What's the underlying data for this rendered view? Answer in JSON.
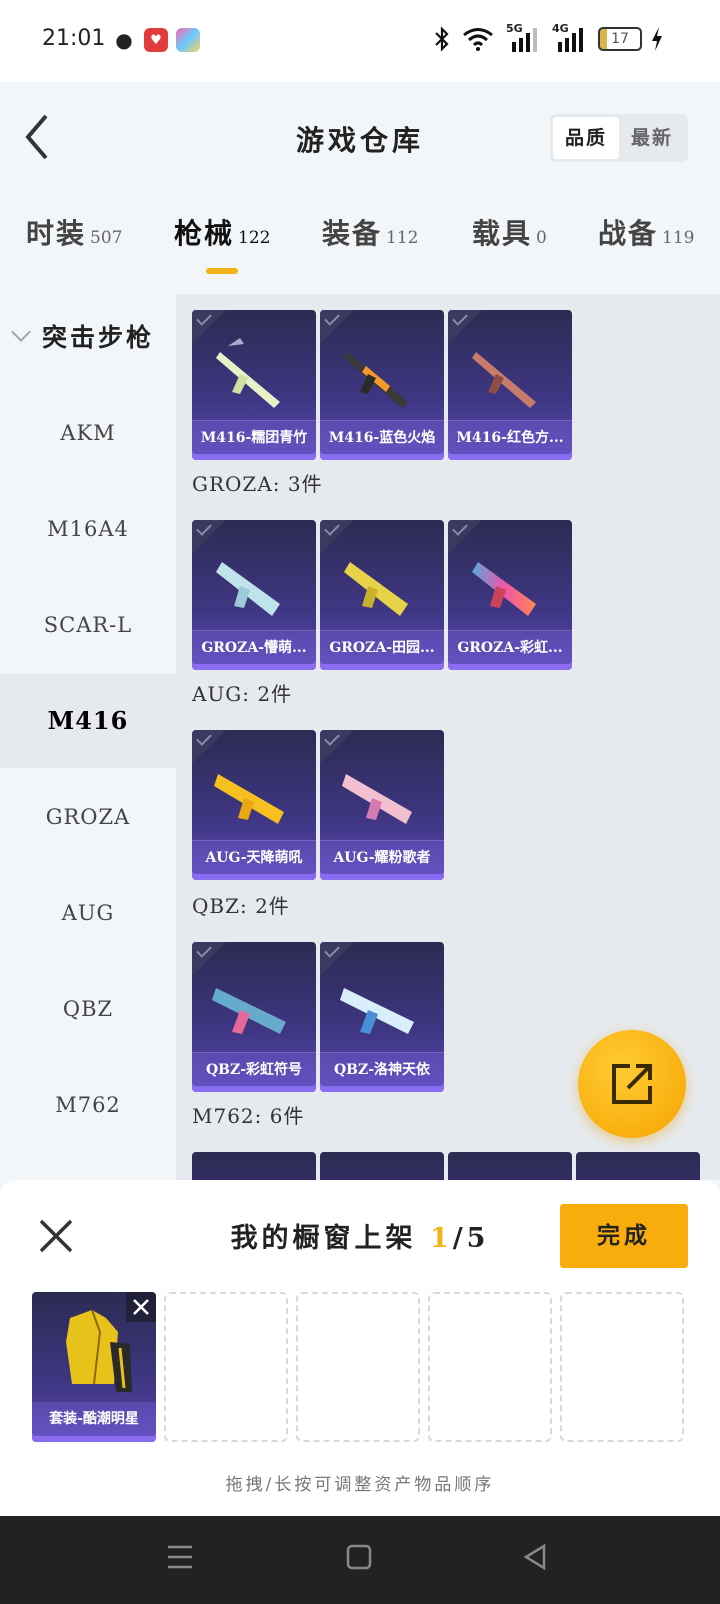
{
  "status_bar": {
    "time": "21:01",
    "battery": "17",
    "network1": "5G",
    "network2": "4G"
  },
  "header": {
    "title": "游戏仓库",
    "sort_quality": "品质",
    "sort_latest": "最新"
  },
  "tabs": [
    {
      "label": "时装",
      "count": "507"
    },
    {
      "label": "枪械",
      "count": "122"
    },
    {
      "label": "装备",
      "count": "112"
    },
    {
      "label": "载具",
      "count": "0"
    },
    {
      "label": "战备",
      "count": "119"
    }
  ],
  "sidebar": {
    "category": "突击步枪",
    "items": [
      "AKM",
      "M16A4",
      "SCAR-L",
      "M416",
      "GROZA",
      "AUG",
      "QBZ",
      "M762"
    ]
  },
  "groups": [
    {
      "title": "",
      "items": [
        "M416-糯团青竹",
        "M416-蓝色火焰",
        "M416-红色方..."
      ]
    },
    {
      "title": "GROZA: 3件",
      "items": [
        "GROZA-懵萌...",
        "GROZA-田园...",
        "GROZA-彩虹..."
      ]
    },
    {
      "title": "AUG: 2件",
      "items": [
        "AUG-天降萌吼",
        "AUG-耀粉歌者"
      ]
    },
    {
      "title": "QBZ: 2件",
      "items": [
        "QBZ-彩虹符号",
        "QBZ-洛神天依"
      ]
    },
    {
      "title": "M762: 6件",
      "items": []
    }
  ],
  "panel": {
    "title_prefix": "我的橱窗上架 ",
    "current": "1",
    "total": "/5",
    "done_label": "完成",
    "filled_item": "套装-酷潮明星",
    "hint": "拖拽/长按可调整资产物品顺序"
  },
  "colors": {
    "accent": "#f3b317",
    "card_bg": "#3f3683",
    "done_btn": "#f8ad0c"
  }
}
